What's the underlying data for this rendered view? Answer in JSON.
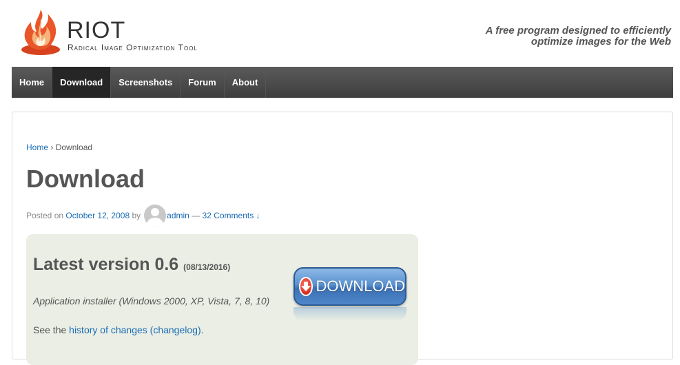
{
  "header": {
    "logo_title": "RIOT",
    "logo_subtitle": "Radical Image Optimization Tool",
    "tagline_line1": "A free program designed to efficiently",
    "tagline_line2": "optimize images for the Web"
  },
  "nav": {
    "items": [
      {
        "label": "Home"
      },
      {
        "label": "Download"
      },
      {
        "label": "Screenshots"
      },
      {
        "label": "Forum"
      },
      {
        "label": "About"
      }
    ],
    "active": "Download"
  },
  "breadcrumb": {
    "home": "Home",
    "separator": "›",
    "current": "Download"
  },
  "page": {
    "title": "Download",
    "meta": {
      "posted_on": "Posted on",
      "date": "October 12, 2008",
      "by": "by",
      "author": "admin",
      "dash": "—",
      "comments": "32 Comments ↓"
    }
  },
  "download_box": {
    "heading": "Latest version 0.6",
    "release_date": "(08/13/2016)",
    "description": "Application installer (Windows 2000, XP, Vista, 7, 8, 10)",
    "changelog_prefix": "See the",
    "changelog_link": "history of changes (changelog)",
    "changelog_suffix": ".",
    "button_label": "DOWNLOAD"
  },
  "colors": {
    "nav_bg": "#4a4a4a",
    "nav_active": "#262626",
    "link": "#1a6db5",
    "box_bg": "#ebeee4",
    "button_blue": "#4f86c9",
    "arrow_red": "#c81d12"
  },
  "icons": [
    "flame-logo-icon",
    "avatar-icon",
    "download-arrow-icon"
  ]
}
